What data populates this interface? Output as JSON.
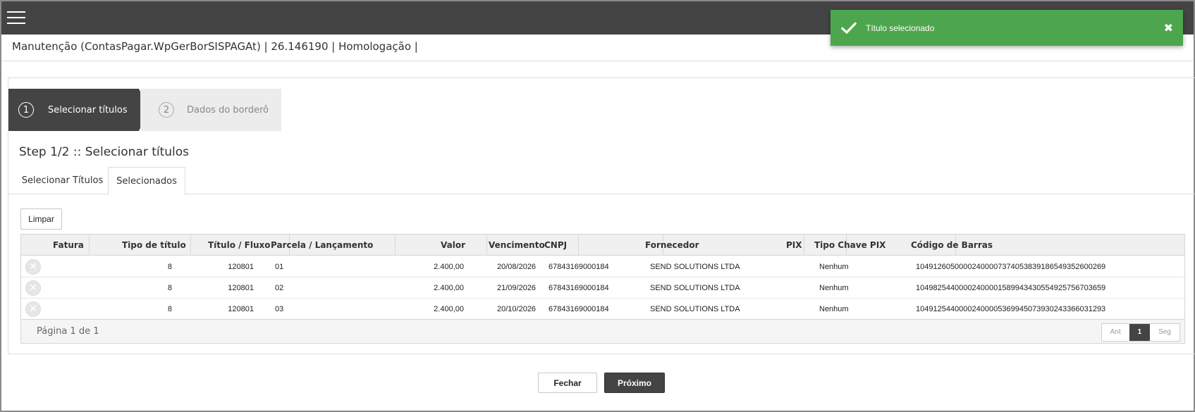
{
  "toast": {
    "message": "Título selecionado",
    "close_symbol": "✖",
    "icon": "check-icon",
    "color": "#4da64d"
  },
  "header": {
    "menu_icon": "hamburger-menu-icon",
    "title": "Manutenção (ContasPagar.WpGerBorSISPAGAt) | 26.146190 | Homologação |"
  },
  "wizard": {
    "steps": [
      {
        "number": "1",
        "label": "Selecionar títulos",
        "active": true
      },
      {
        "number": "2",
        "label": "Dados do borderô",
        "active": false
      }
    ]
  },
  "step_title": "Step 1/2 :: Selecionar títulos",
  "tabs": [
    {
      "label": "Selecionar Títulos",
      "active": false
    },
    {
      "label": "Selecionados",
      "active": true
    }
  ],
  "clear_button": "Limpar",
  "table": {
    "columns": [
      "Fatura",
      "Tipo de título",
      "Título / Fluxo",
      "Parcela / Lançamento",
      "Valor",
      "Vencimento",
      "CNPJ",
      "Fornecedor",
      "PIX",
      "Tipo Chave PIX",
      "Código de Barras"
    ],
    "rows": [
      {
        "tipo": "8",
        "titulo": "120801",
        "parcela": "01",
        "valor": "2.400,00",
        "vencimento": "20/08/2026",
        "cnpj": "67843169000184",
        "fornecedor": "SEND SOLUTIONS LTDA",
        "pix": "",
        "tipo_chave": "Nenhum",
        "codigo": "10491260500002400007374053839186549352600269"
      },
      {
        "tipo": "8",
        "titulo": "120801",
        "parcela": "02",
        "valor": "2.400,00",
        "vencimento": "21/09/2026",
        "cnpj": "67843169000184",
        "fornecedor": "SEND SOLUTIONS LTDA",
        "pix": "",
        "tipo_chave": "Nenhum",
        "codigo": "10498254400002400001589943430554925756703659"
      },
      {
        "tipo": "8",
        "titulo": "120801",
        "parcela": "03",
        "valor": "2.400,00",
        "vencimento": "20/10/2026",
        "cnpj": "67843169000184",
        "fornecedor": "SEND SOLUTIONS LTDA",
        "pix": "",
        "tipo_chave": "Nenhum",
        "codigo": "10491254400002400005369945073930243366031293"
      }
    ],
    "remove_symbol": "✕",
    "page_info": "Página 1 de 1",
    "pager": {
      "prev": "Ant",
      "current": "1",
      "next": "Seg"
    }
  },
  "footer": {
    "close_button": "Fechar",
    "next_button": "Próximo"
  }
}
